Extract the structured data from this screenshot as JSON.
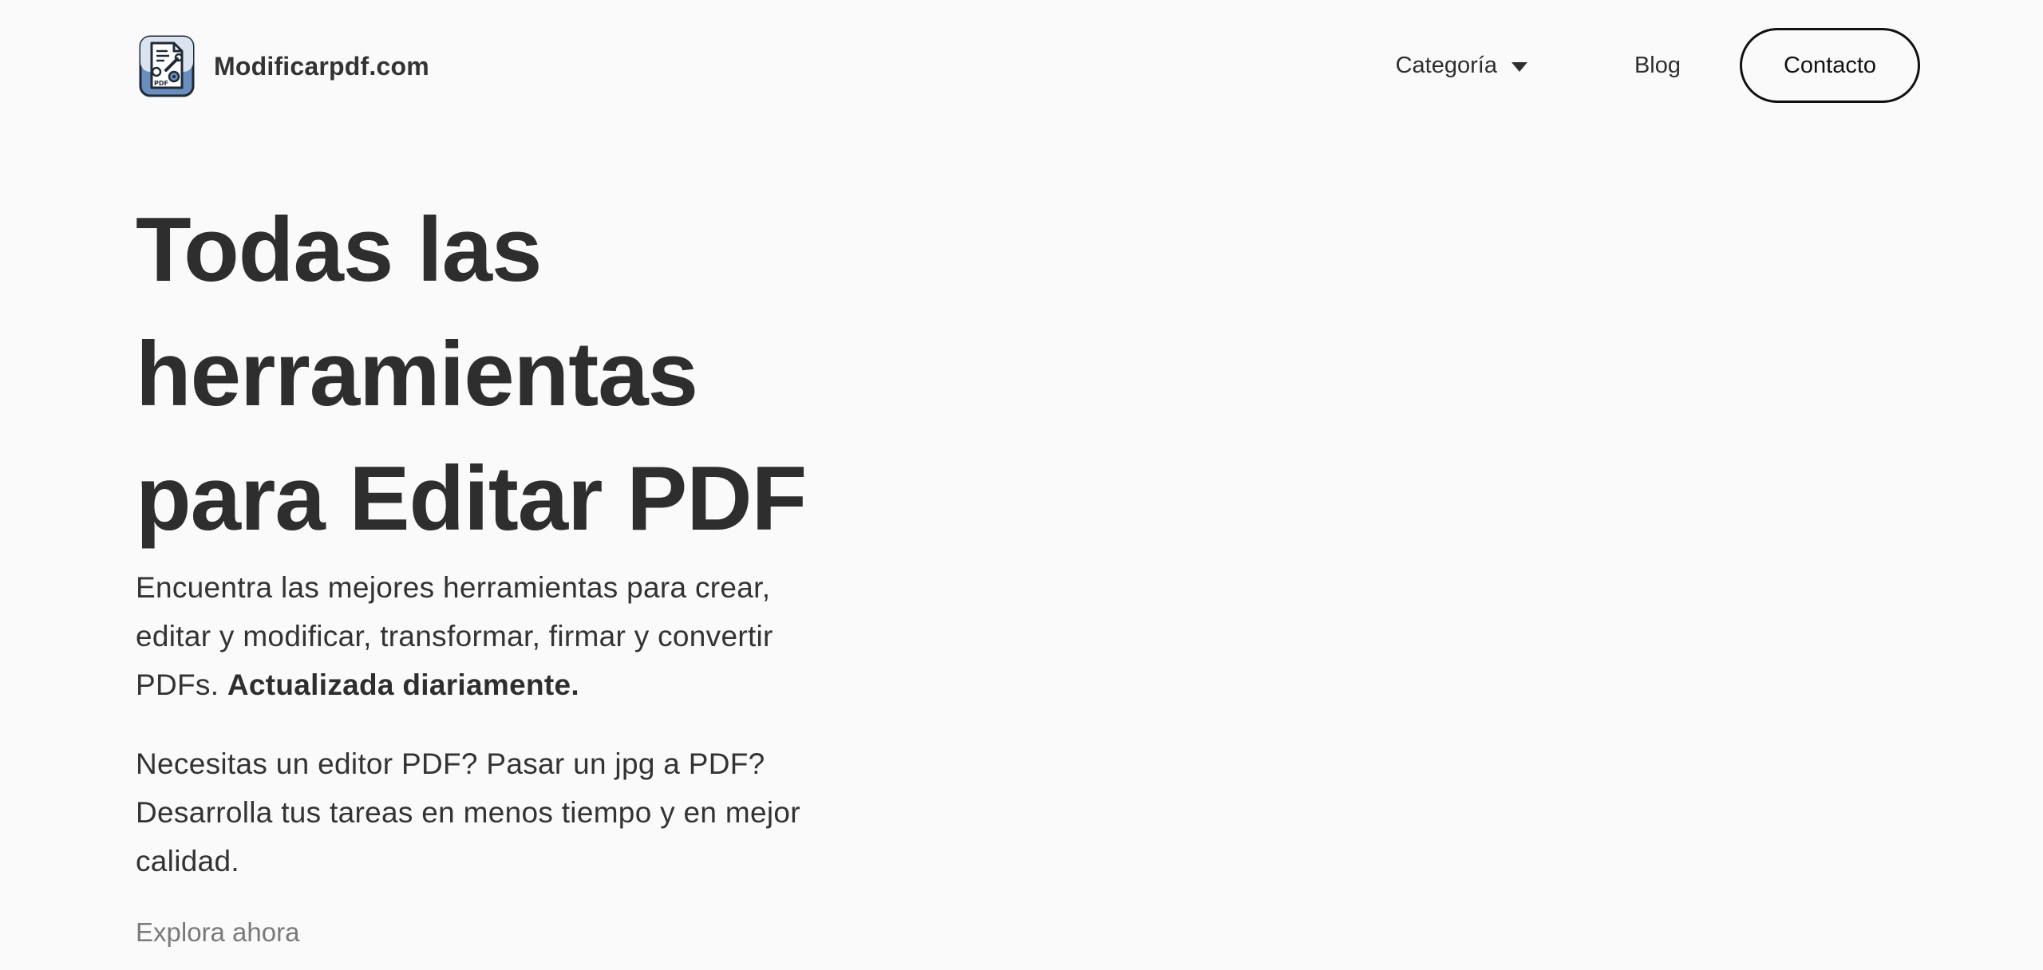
{
  "header": {
    "brand_name": "Modificarpdf.com",
    "logo_icon": "pdf-tools-logo-icon",
    "logo_text": "PDF",
    "nav": {
      "category_label": "Categoría",
      "blog_label": "Blog",
      "contact_label": "Contacto"
    }
  },
  "hero": {
    "title_line1": "Todas las",
    "title_line2": "herramientas",
    "title_line3": "para Editar PDF",
    "description": "Encuentra las mejores herramientas para crear, editar y modificar, transformar, firmar y convertir PDFs.",
    "description_bold": "Actualizada diariamente.",
    "description2": "Necesitas un editor PDF? Pasar un jpg a PDF? Desarrolla tus tareas en menos tiempo y en mejor calidad.",
    "explore_label": "Explora ahora"
  },
  "colors": {
    "background": "#fafafa",
    "text": "#2e2e2e",
    "muted": "#7a7a7a",
    "logo_blue": "#6a8fbf",
    "logo_dark": "#1f2a36"
  }
}
